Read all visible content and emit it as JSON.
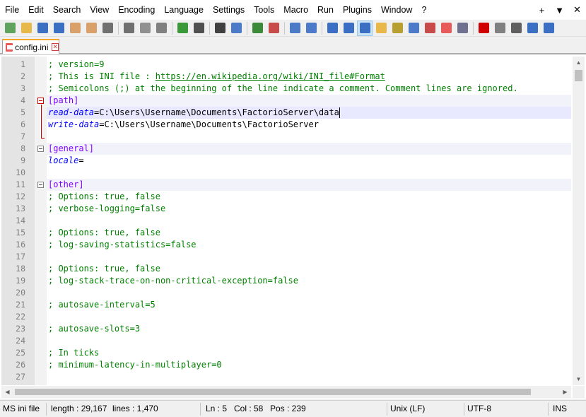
{
  "menu": {
    "items": [
      "File",
      "Edit",
      "Search",
      "View",
      "Encoding",
      "Language",
      "Settings",
      "Tools",
      "Macro",
      "Run",
      "Plugins",
      "Window",
      "?"
    ],
    "right": [
      "+",
      "▼",
      "✕"
    ]
  },
  "toolbar": {
    "buttons": [
      {
        "name": "new-file-icon",
        "color": "#5fa35f"
      },
      {
        "name": "open-file-icon",
        "color": "#e8b84a"
      },
      {
        "name": "save-icon",
        "color": "#3a6fc4"
      },
      {
        "name": "save-all-icon",
        "color": "#3a6fc4"
      },
      {
        "name": "close-icon",
        "color": "#d9a06a"
      },
      {
        "name": "close-all-icon",
        "color": "#d9a06a"
      },
      {
        "name": "print-icon",
        "color": "#707070"
      },
      {
        "sep": true
      },
      {
        "name": "cut-icon",
        "color": "#707070"
      },
      {
        "name": "copy-icon",
        "color": "#909090"
      },
      {
        "name": "paste-icon",
        "color": "#808080"
      },
      {
        "sep": true
      },
      {
        "name": "undo-icon",
        "color": "#3a9a3a"
      },
      {
        "name": "redo-icon",
        "color": "#505050"
      },
      {
        "sep": true
      },
      {
        "name": "find-icon",
        "color": "#404040"
      },
      {
        "name": "replace-icon",
        "color": "#4a7ac8"
      },
      {
        "sep": true
      },
      {
        "name": "zoom-in-icon",
        "color": "#3a8a3a"
      },
      {
        "name": "zoom-out-icon",
        "color": "#c84a4a"
      },
      {
        "sep": true
      },
      {
        "name": "sync-vertical-icon",
        "color": "#4a7ac8"
      },
      {
        "name": "sync-horizontal-icon",
        "color": "#4a7ac8"
      },
      {
        "sep": true
      },
      {
        "name": "word-wrap-icon",
        "color": "#3a6fc4"
      },
      {
        "name": "show-all-chars-icon",
        "color": "#3a6fc4"
      },
      {
        "name": "indent-guide-icon",
        "color": "#3a6fc4",
        "active": true
      },
      {
        "name": "udl-icon",
        "color": "#e8b84a"
      },
      {
        "name": "doc-map-icon",
        "color": "#b8a030"
      },
      {
        "name": "doc-list-icon",
        "color": "#4a7ac8"
      },
      {
        "name": "function-list-icon",
        "color": "#c84a4a"
      },
      {
        "name": "folder-workspace-icon",
        "color": "#e85a5a"
      },
      {
        "name": "monitoring-icon",
        "color": "#707090"
      },
      {
        "sep": true
      },
      {
        "name": "record-macro-icon",
        "color": "#d00000"
      },
      {
        "name": "stop-record-icon",
        "color": "#808080"
      },
      {
        "name": "play-macro-icon",
        "color": "#606060"
      },
      {
        "name": "run-macro-multiple-icon",
        "color": "#3a6fc4"
      },
      {
        "name": "save-macro-icon",
        "color": "#3a6fc4"
      }
    ]
  },
  "tab": {
    "label": "config.ini",
    "close": "✕"
  },
  "editor": {
    "lines": [
      {
        "n": "1",
        "parts": [
          [
            "cmt",
            "; version=9"
          ]
        ]
      },
      {
        "n": "2",
        "parts": [
          [
            "cmt",
            "; This is INI file : "
          ],
          [
            "url",
            "https://en.wikipedia.org/wiki/INI_file#Format"
          ]
        ]
      },
      {
        "n": "3",
        "parts": [
          [
            "cmt",
            "; Semicolons (;) at the beginning of the line indicate a comment. Comment lines are ignored."
          ]
        ]
      },
      {
        "n": "4",
        "parts": [
          [
            "sect",
            "[path]"
          ]
        ],
        "hl": "section",
        "fold": "red"
      },
      {
        "n": "5",
        "parts": [
          [
            "key",
            "read-data"
          ],
          [
            "eq",
            "="
          ],
          [
            "val",
            "C:\\Users\\Username\\Documents\\FactorioServer\\data"
          ]
        ],
        "hl": "current",
        "caret": true
      },
      {
        "n": "6",
        "parts": [
          [
            "key",
            "write-data"
          ],
          [
            "eq",
            "="
          ],
          [
            "val",
            "C:\\Users\\Username\\Documents\\FactorioServer"
          ]
        ]
      },
      {
        "n": "7",
        "parts": [],
        "foldend": true
      },
      {
        "n": "8",
        "parts": [
          [
            "sect",
            "[general]"
          ]
        ],
        "hl": "section",
        "fold": "grey"
      },
      {
        "n": "9",
        "parts": [
          [
            "key",
            "locale"
          ],
          [
            "eq",
            "="
          ]
        ]
      },
      {
        "n": "10",
        "parts": []
      },
      {
        "n": "11",
        "parts": [
          [
            "sect",
            "[other]"
          ]
        ],
        "hl": "section",
        "fold": "grey"
      },
      {
        "n": "12",
        "parts": [
          [
            "cmt",
            "; Options: true, false"
          ]
        ]
      },
      {
        "n": "13",
        "parts": [
          [
            "cmt",
            "; verbose-logging=false"
          ]
        ]
      },
      {
        "n": "14",
        "parts": []
      },
      {
        "n": "15",
        "parts": [
          [
            "cmt",
            "; Options: true, false"
          ]
        ]
      },
      {
        "n": "16",
        "parts": [
          [
            "cmt",
            "; log-saving-statistics=false"
          ]
        ]
      },
      {
        "n": "17",
        "parts": []
      },
      {
        "n": "18",
        "parts": [
          [
            "cmt",
            "; Options: true, false"
          ]
        ]
      },
      {
        "n": "19",
        "parts": [
          [
            "cmt",
            "; log-stack-trace-on-non-critical-exception=false"
          ]
        ]
      },
      {
        "n": "20",
        "parts": []
      },
      {
        "n": "21",
        "parts": [
          [
            "cmt",
            "; autosave-interval=5"
          ]
        ]
      },
      {
        "n": "22",
        "parts": []
      },
      {
        "n": "23",
        "parts": [
          [
            "cmt",
            "; autosave-slots=3"
          ]
        ]
      },
      {
        "n": "24",
        "parts": []
      },
      {
        "n": "25",
        "parts": [
          [
            "cmt",
            "; In ticks"
          ]
        ]
      },
      {
        "n": "26",
        "parts": [
          [
            "cmt",
            "; minimum-latency-in-multiplayer=0"
          ]
        ]
      },
      {
        "n": "27",
        "parts": []
      }
    ]
  },
  "status": {
    "language": "MS ini file",
    "length": "length : 29,167",
    "lines": "lines : 1,470",
    "ln": "Ln : 5",
    "col": "Col : 58",
    "pos": "Pos : 239",
    "eol": "Unix (LF)",
    "encoding": "UTF-8",
    "mode": "INS"
  }
}
